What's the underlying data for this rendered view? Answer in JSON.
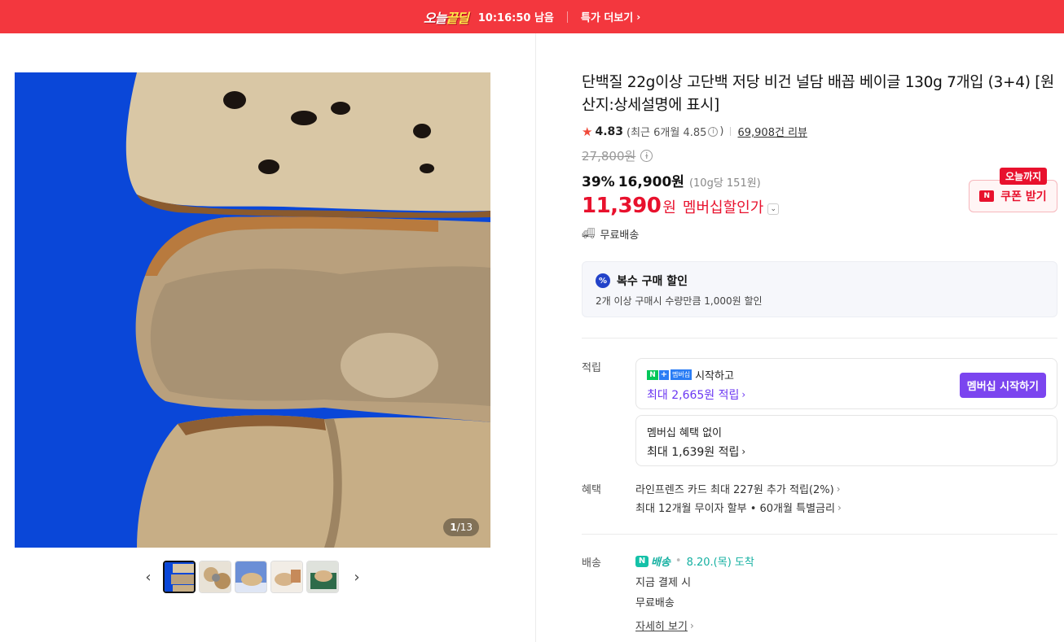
{
  "banner": {
    "logo_pre": "오늘",
    "logo_hl": "끝딜",
    "timer": "10:16:50 남음",
    "more": "특가 더보기"
  },
  "gallery": {
    "counter_current": "1",
    "counter_total": "/13"
  },
  "product": {
    "title": "단백질 22g이상 고단백 저당 비건 널담 배꼽 베이글 130g 7개입 (3+4) [원산지:상세설명에 표시]",
    "rating": "4.83",
    "recent": "(최근 6개월 4.85",
    "recent_close": ")",
    "reviews": "69,908건 리뷰",
    "original_price": "27,800원",
    "discount": "39%",
    "sale_price": "16,900원",
    "unit_price": "(10g당 151원)",
    "member_price": "11,390",
    "member_won": "원",
    "member_label": "멤버십할인가",
    "shipping": "무료배송"
  },
  "coupon": {
    "tag": "오늘까지",
    "label": "쿠폰 받기",
    "icon": "N"
  },
  "multi_discount": {
    "title": "복수 구매 할인",
    "desc": "2개 이상 구매시 수량만큼 1,000원 할인"
  },
  "points": {
    "label": "적립",
    "member_badge": "멤버십",
    "member_start": "시작하고",
    "member_max": "최대 2,665원 적립",
    "member_btn": "멤버십 시작하기",
    "nonmember_title": "멤버십 혜택 없이",
    "nonmember_max": "최대 1,639원 적립"
  },
  "benefits": {
    "label": "혜택",
    "card": "라인프렌즈 카드 최대 227원 추가 적립(2%)",
    "installment": "최대 12개월 무이자 할부 • 60개월 특별금리"
  },
  "delivery": {
    "label": "배송",
    "n_text": "배송",
    "date": "8.20.(목) 도착",
    "pay_now": "지금 결제 시",
    "free": "무료배송",
    "detail": "자세히 보기"
  },
  "colors": {
    "banner": "#f3373e",
    "price_red": "#e8112d",
    "membership_purple": "#7b45ef",
    "n_delivery": "#14c1a8"
  }
}
